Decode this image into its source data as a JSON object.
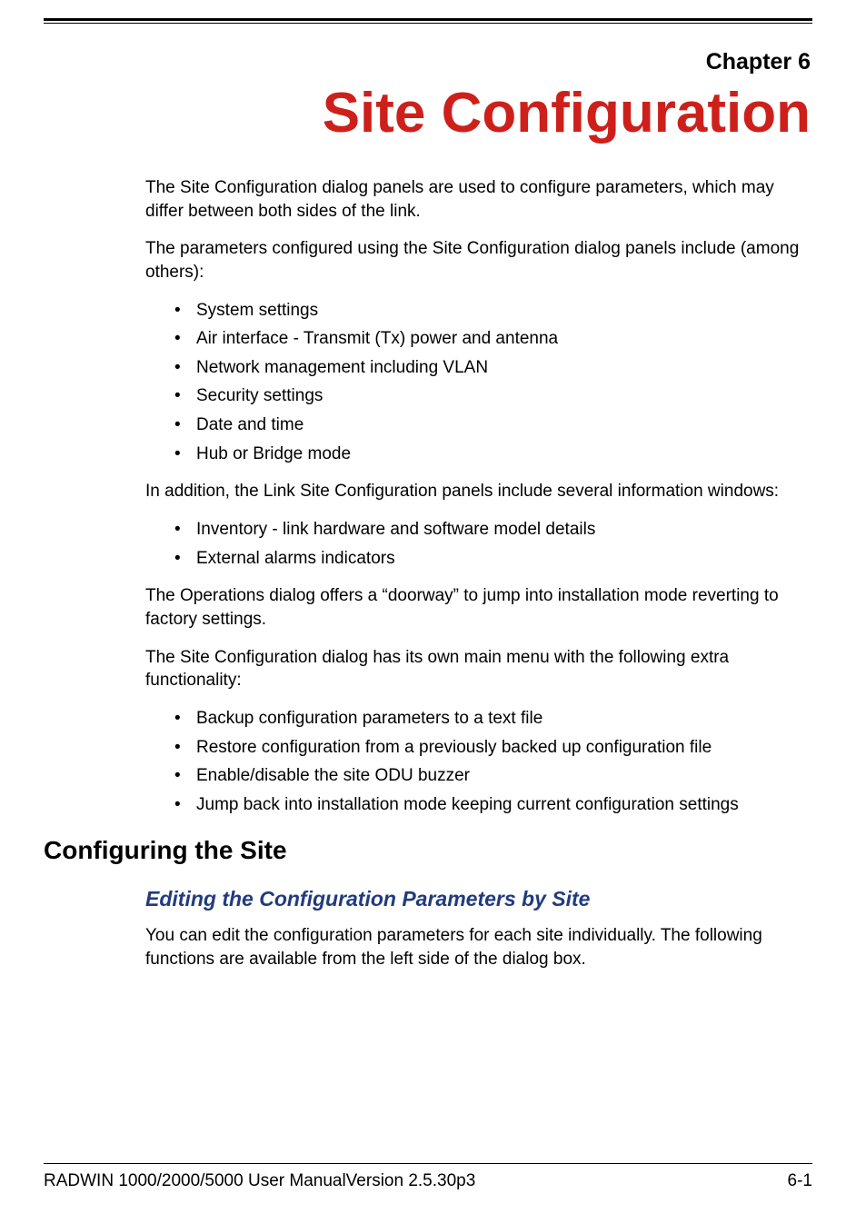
{
  "chapter": {
    "label": "Chapter 6",
    "title": "Site Configuration"
  },
  "paragraphs": {
    "intro1": "The Site Configuration dialog panels are used to configure parameters, which may differ between both sides of the link.",
    "intro2": "The parameters configured using the Site Configuration dialog panels include (among others):",
    "after_list1": "In addition, the Link Site Configuration panels include several information windows:",
    "after_list2": "The Operations dialog offers a “doorway” to jump into installation mode reverting to factory settings.",
    "after_list3": "The Site Configuration dialog has its own main menu with the following extra functionality:"
  },
  "list1": {
    "items": [
      "System settings",
      "Air interface - Transmit (Tx) power and antenna",
      "Network management including VLAN",
      "Security settings",
      "Date and time",
      "Hub or Bridge mode"
    ]
  },
  "list2": {
    "items": [
      "Inventory - link hardware and software model details",
      "External alarms indicators"
    ]
  },
  "list3": {
    "items": [
      "Backup configuration parameters to a text file",
      "Restore configuration from a previously backed up configuration file",
      "Enable/disable the site ODU buzzer",
      "Jump back into installation mode keeping current configuration settings"
    ]
  },
  "section": {
    "heading": "Configuring the Site",
    "subheading": "Editing the Configuration Parameters by Site",
    "body": "You can edit the configuration parameters for each site individually. The following functions are available from the left side of the dialog box."
  },
  "footer": {
    "left": "RADWIN 1000/2000/5000 User ManualVersion 2.5.30p3",
    "right": "6-1"
  }
}
